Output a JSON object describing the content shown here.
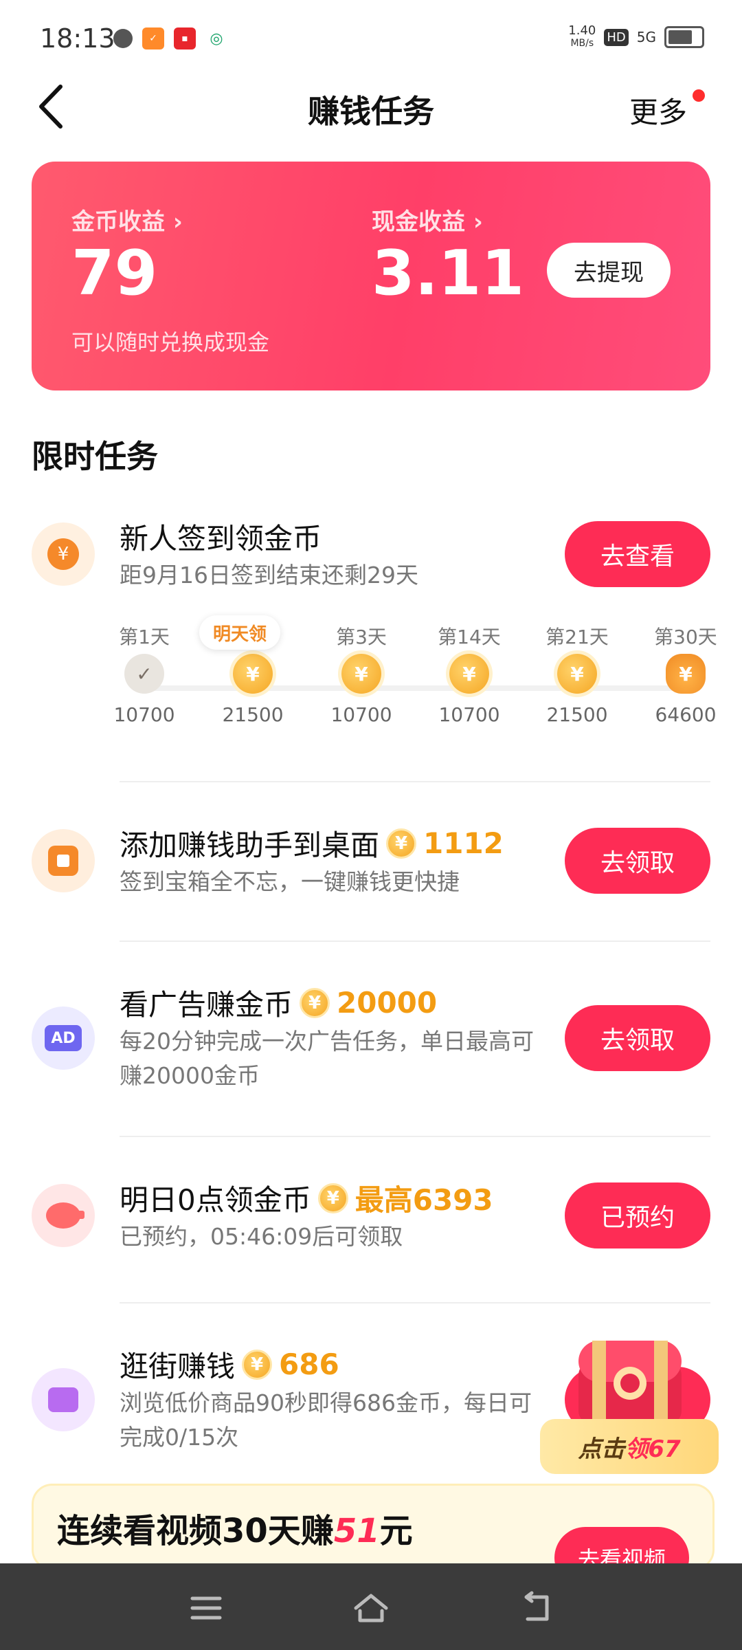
{
  "status_bar": {
    "time": "18:13",
    "speed_top": "1.40",
    "speed_unit": "MB/s",
    "hd": "HD",
    "net": "5G"
  },
  "header": {
    "title": "赚钱任务",
    "more": "更多"
  },
  "earnings": {
    "coin_label": "金币收益",
    "coin_value": "79",
    "coin_sub": "可以随时兑换成现金",
    "cash_label": "现金收益",
    "cash_value": "3.11",
    "withdraw": "去提现"
  },
  "section_title": "限时任务",
  "checkin": {
    "title": "新人签到领金币",
    "desc": "距9月16日签到结束还剩29天",
    "button": "去查看",
    "tomorrow_badge": "明天领",
    "days": [
      {
        "label": "第1天",
        "amount": "10700",
        "state": "done"
      },
      {
        "label": "",
        "amount": "21500",
        "state": "coin"
      },
      {
        "label": "第3天",
        "amount": "10700",
        "state": "coin"
      },
      {
        "label": "第14天",
        "amount": "10700",
        "state": "coin"
      },
      {
        "label": "第21天",
        "amount": "21500",
        "state": "coin"
      },
      {
        "label": "第30天",
        "amount": "64600",
        "state": "pile"
      }
    ]
  },
  "tasks": [
    {
      "title": "添加赚钱助手到桌面",
      "reward": "1112",
      "desc": "签到宝箱全不忘，一键赚钱更快捷",
      "button": "去领取",
      "icon": "desktop-square-icon"
    },
    {
      "title": "看广告赚金币",
      "reward": "20000",
      "desc": "每20分钟完成一次广告任务，单日最高可赚20000金币",
      "button": "去领取",
      "icon": "ad-icon"
    },
    {
      "title": "明日0点领金币",
      "reward": "最高6393",
      "desc": "已预约，05:46:09后可领取",
      "button": "已预约",
      "icon": "piggy-bank-icon"
    },
    {
      "title": "逛街赚钱",
      "reward": "686",
      "desc": "浏览低价商品90秒即得686金币，每日可完成0/15次",
      "button": "",
      "icon": "shop-icon"
    }
  ],
  "float_badge": {
    "prefix": "点击",
    "highlight": "领67"
  },
  "banner": {
    "prefix": "连续看视频30天赚",
    "number": "51",
    "suffix": "元",
    "button": "去看视频"
  },
  "colors": {
    "accent": "#fe2c55",
    "gold": "#f39c12",
    "card_start": "#ff5a6e",
    "card_end": "#ff4d7a"
  }
}
